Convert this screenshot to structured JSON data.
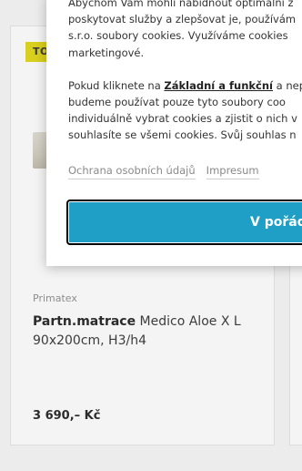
{
  "product": {
    "badge": "TOP",
    "brand": "Primatex",
    "name_bold": "Partn.matrace",
    "name_rest": " Medico Aloe X L 90x200cm, H3/h4",
    "price": "3 690,– Kč"
  },
  "cookie_modal": {
    "lines": [
      "Abychom Vám mohli nabídnout optimální z",
      "poskytovat služby a zlepšovat je, používám",
      "s.r.o. soubory cookies. Využíváme cookies",
      "marketingové."
    ],
    "p2_line1_prefix": "Pokud kliknete na ",
    "p2_line1_bold": "Základní a funkční",
    "p2_line1_suffix": " a nep",
    "p2_lines": [
      "budeme používat pouze tyto soubory coo",
      "individuálně vybrat cookies a zjistit o nich v",
      "souhlasíte se všemi cookies. Svůj souhlas n"
    ],
    "link_privacy": "Ochrana osobních údajů",
    "link_imprint": "Impresum",
    "accept_label": "V pořád"
  },
  "colors": {
    "accent": "#1f9fc6",
    "badge": "#d8cf1e"
  }
}
